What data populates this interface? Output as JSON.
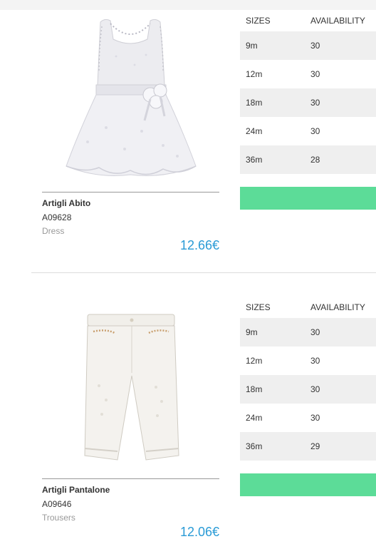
{
  "products": [
    {
      "name": "Artigli Abito",
      "code": "A09628",
      "category": "Dress",
      "price": "12.66€",
      "image_icon": "dress-image",
      "sizes_header": "SIZES",
      "availability_header": "AVAILABILITY",
      "sizes": [
        {
          "size": "9m",
          "availability": "30"
        },
        {
          "size": "12m",
          "availability": "30"
        },
        {
          "size": "18m",
          "availability": "30"
        },
        {
          "size": "24m",
          "availability": "30"
        },
        {
          "size": "36m",
          "availability": "28"
        }
      ],
      "button_color": "#5cdc98"
    },
    {
      "name": "Artigli Pantalone",
      "code": "A09646",
      "category": "Trousers",
      "price": "12.06€",
      "image_icon": "trousers-image",
      "sizes_header": "SIZES",
      "availability_header": "AVAILABILITY",
      "sizes": [
        {
          "size": "9m",
          "availability": "30"
        },
        {
          "size": "12m",
          "availability": "30"
        },
        {
          "size": "18m",
          "availability": "30"
        },
        {
          "size": "24m",
          "availability": "30"
        },
        {
          "size": "36m",
          "availability": "29"
        }
      ],
      "button_color": "#5cdc98"
    }
  ],
  "colors": {
    "price": "#2a9bd6",
    "accent_button": "#5cdc98",
    "row_shade": "#efefef"
  }
}
